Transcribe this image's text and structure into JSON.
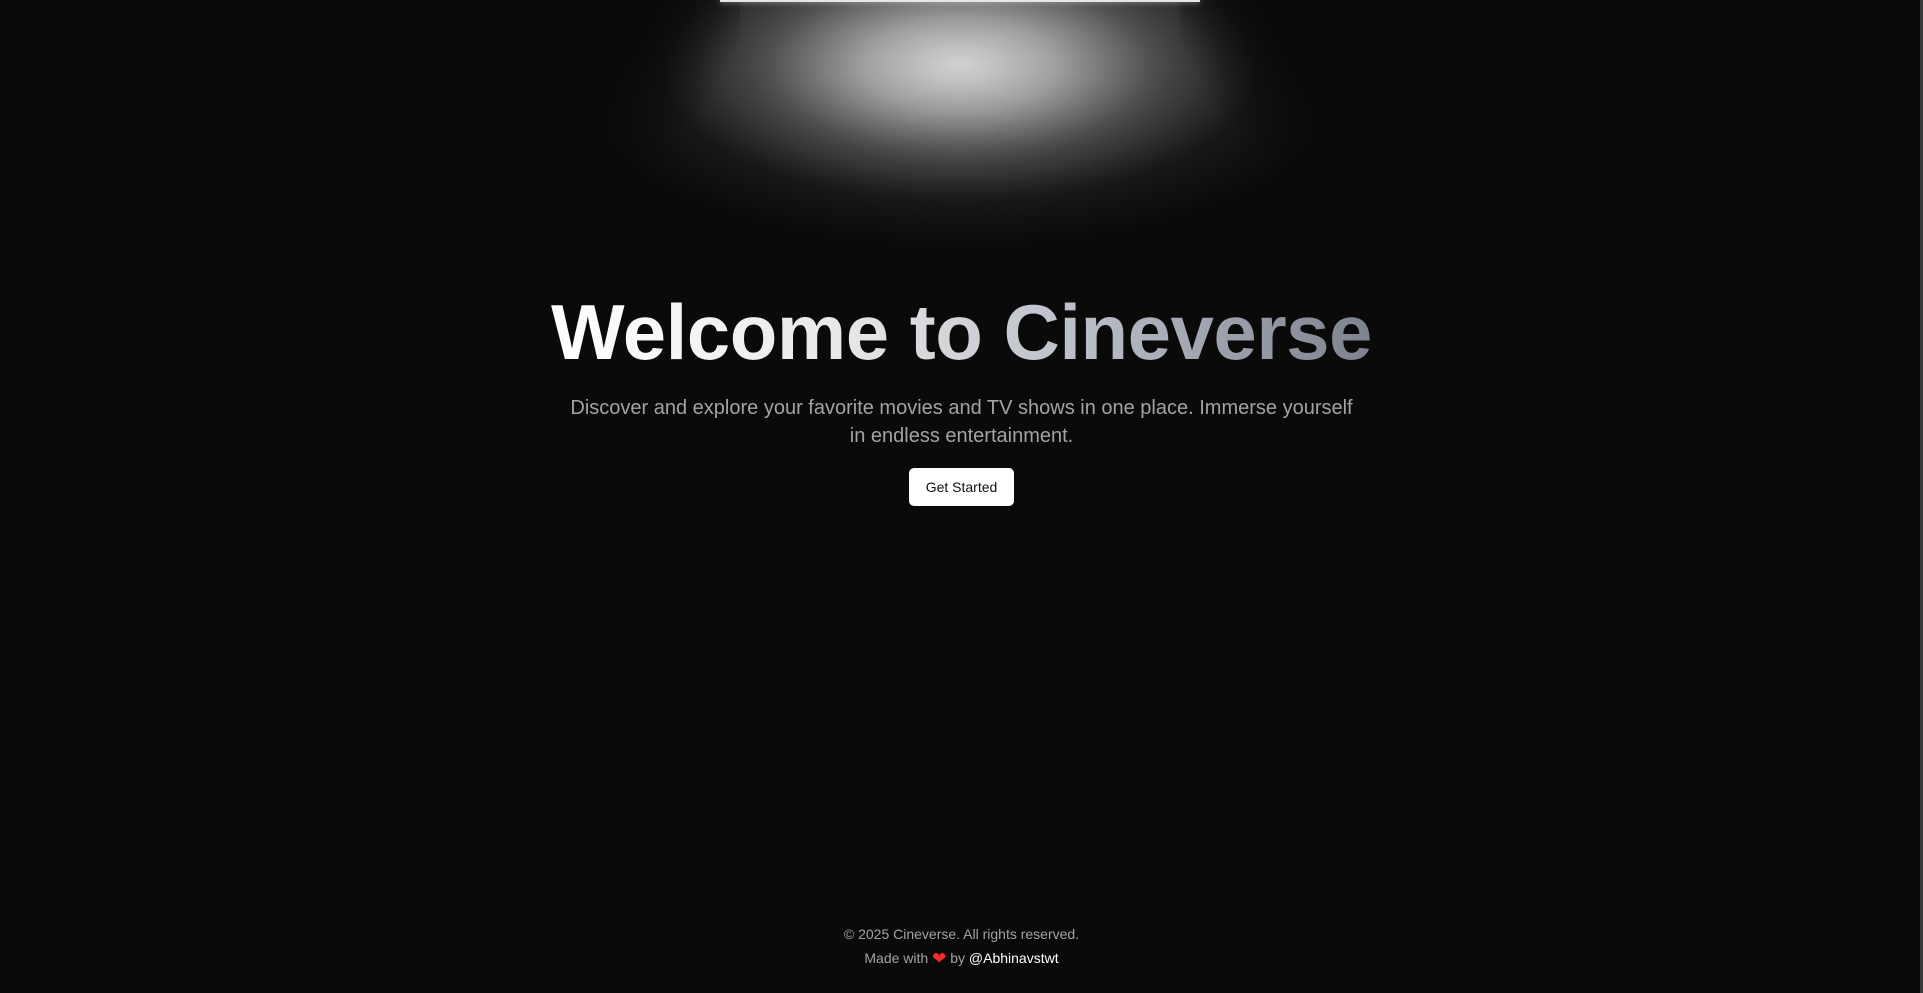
{
  "hero": {
    "title": "Welcome to Cineverse",
    "subtitle": "Discover and explore your favorite movies and TV shows in one place. Immerse yourself in endless entertainment.",
    "cta_label": "Get Started"
  },
  "footer": {
    "copyright": "© 2025 Cineverse. All rights reserved.",
    "made_with": "Made with",
    "heart": "❤",
    "by": "by",
    "author": "@Abhinavstwt"
  },
  "colors": {
    "background": "#0a0a0a",
    "button_bg": "#ffffff",
    "button_text": "#111111",
    "muted_text": "#a3a3a3",
    "heart": "#ef2b2b"
  },
  "icons": [
    "heart-icon"
  ]
}
